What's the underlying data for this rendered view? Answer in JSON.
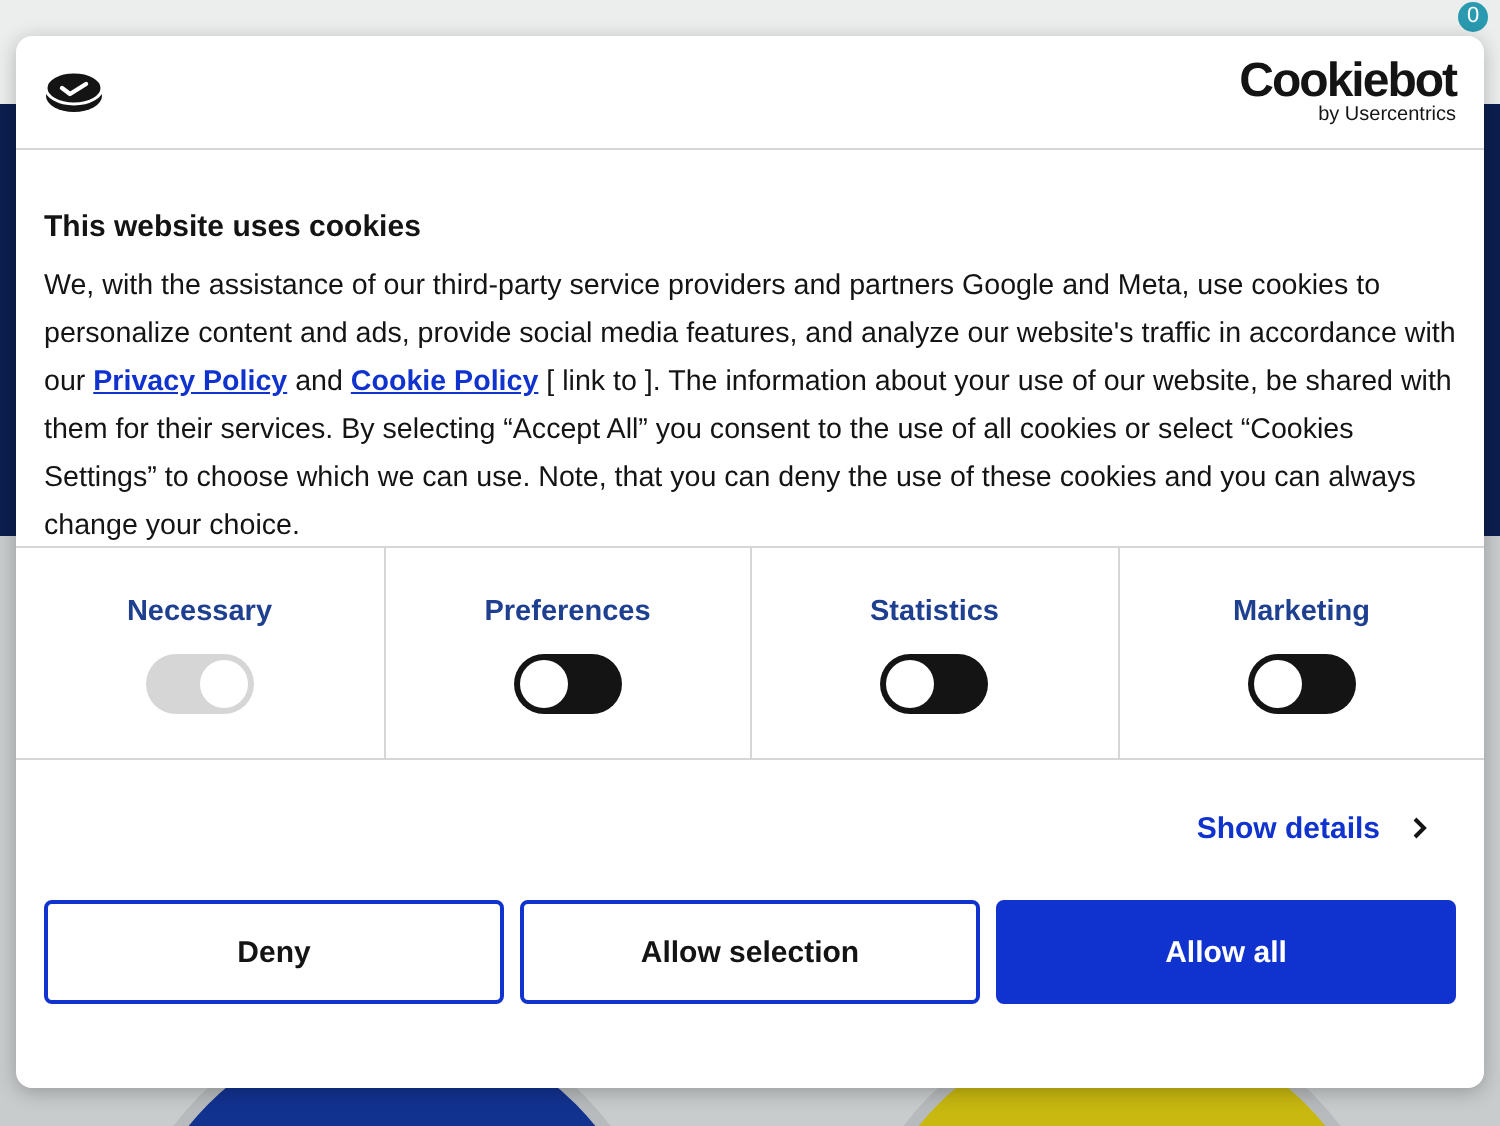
{
  "background_page": {
    "cart_badge": "0"
  },
  "dialog": {
    "brand": {
      "name": "Cookiebot",
      "subtitle": "by Usercentrics"
    },
    "title": "This website uses cookies",
    "body": "We, with the assistance of our third-party service providers and partners Google and Meta, use cookies to personalize content and ads, provide social media features, and analyze our website's traffic in accordance with our ",
    "links": [
      {
        "label": "Privacy Policy",
        "after": " and "
      },
      {
        "label": "Cookie Policy",
        "after": " [ link to ].  The information about your use of our website, be shared with them for their services. By selecting “Accept All” you consent to the use of all cookies or select “Cookies Settings” to choose which we can use. Note, that you can deny the use of these cookies and you can always change your choice."
      }
    ],
    "categories": [
      {
        "label": "Necessary",
        "on": true,
        "disabled": true
      },
      {
        "label": "Preferences",
        "on": false,
        "disabled": false
      },
      {
        "label": "Statistics",
        "on": false,
        "disabled": false
      },
      {
        "label": "Marketing",
        "on": false,
        "disabled": false
      }
    ],
    "details_link": "Show details",
    "buttons": [
      {
        "label": "Deny",
        "kind": "outline"
      },
      {
        "label": "Allow selection",
        "kind": "outline"
      },
      {
        "label": "Allow all",
        "kind": "primary"
      }
    ]
  }
}
